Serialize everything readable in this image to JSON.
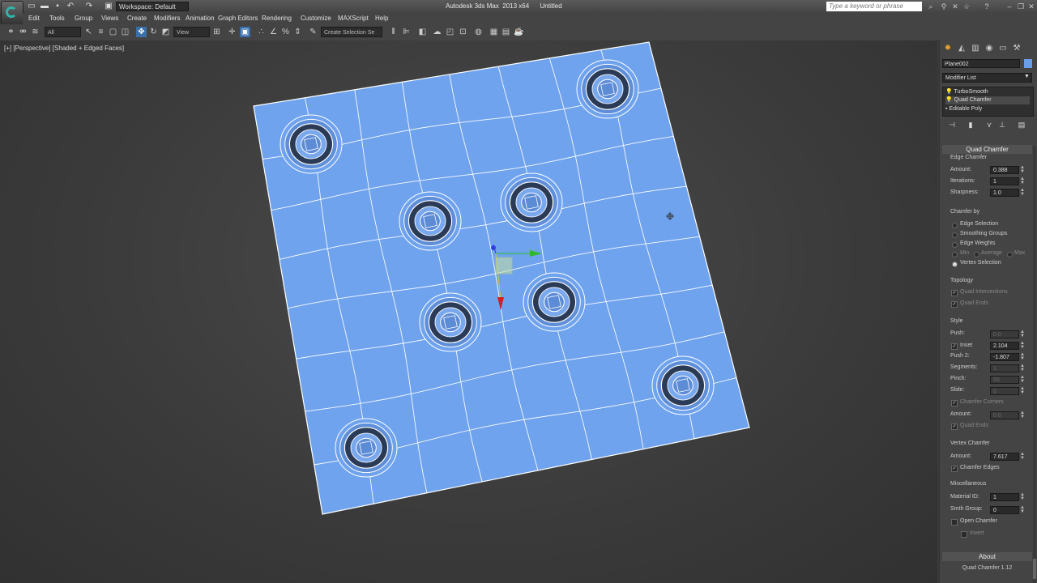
{
  "titlebar": {
    "workspace": "Workspace: Default",
    "app_title": "Autodesk 3ds Max  2013 x64      Untitled",
    "search_placeholder": "Type a keyword or phrase"
  },
  "menus": [
    "Edit",
    "Tools",
    "Group",
    "Views",
    "Create",
    "Modifiers",
    "Animation",
    "Graph Editors",
    "Rendering",
    "Customize",
    "MAXScript",
    "Help"
  ],
  "toolbar": {
    "filter": "All",
    "refcoord": "View",
    "selection_set_placeholder": "Create Selection Se"
  },
  "viewport": {
    "label": "[+] [Perspective] [Shaded + Edged Faces]",
    "colors": {
      "plane": "#6fa3ee",
      "wire": "#ffffff",
      "hole": "#1a1f2a"
    }
  },
  "panel": {
    "object_name": "Plane002",
    "object_color": "#6a9ee8",
    "modifier_list": "Modifier List",
    "stack": [
      "TurboSmooth",
      "Quad Chamfer",
      "Editable Poly"
    ],
    "rollout_title": "Quad Chamfer",
    "edge_chamfer": {
      "title": "Edge Chamfer",
      "amount_label": "Amount:",
      "amount": "0.388",
      "iterations_label": "Iterations:",
      "iterations": "1",
      "sharpness_label": "Sharpness:",
      "sharpness": "1.0"
    },
    "chamfer_by": {
      "title": "Chamfer by",
      "options": [
        "Edge Selection",
        "Smoothing Groups",
        "Edge Weights"
      ],
      "weights": [
        "Min",
        "Average",
        "Max"
      ],
      "vertex_selection": "Vertex Selection"
    },
    "topology": {
      "title": "Topology",
      "quad_intersections": "Quad Intersections",
      "quad_ends": "Quad Ends"
    },
    "style": {
      "title": "Style",
      "push_label": "Push:",
      "push": "0.0",
      "inset_label": "Inset",
      "inset": "2.104",
      "push2_label": "Push 2:",
      "push2": "-1.807",
      "segments_label": "Segments:",
      "segments": "1",
      "pinch_label": "Pinch:",
      "pinch": "50",
      "slide_label": "Slide:",
      "slide": "0",
      "chamfer_corners": "Chamfer Corners",
      "amount_label": "Amount:",
      "amount": "0.0",
      "quad_ends": "Quad Ends"
    },
    "vertex_chamfer": {
      "title": "Vertex Chamfer",
      "amount_label": "Amount:",
      "amount": "7.617",
      "chamfer_edges": "Chamfer Edges"
    },
    "misc": {
      "title": "Miscellaneous",
      "material_id_label": "Material ID:",
      "material_id": "1",
      "smth_group_label": "Smth Group:",
      "smth_group": "0",
      "open_chamfer": "Open Chamfer",
      "invert": "Invert"
    },
    "about": {
      "title": "About",
      "version": "Quad Chamfer 1.12"
    }
  }
}
